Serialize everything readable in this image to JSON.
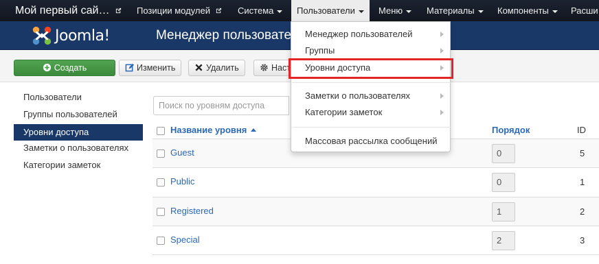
{
  "topnav": {
    "site_name": "Мой первый сай…",
    "items": [
      {
        "label": "Позиции модулей"
      },
      {
        "label": "Система"
      },
      {
        "label": "Пользователи"
      },
      {
        "label": "Меню"
      },
      {
        "label": "Материалы"
      },
      {
        "label": "Компоненты"
      },
      {
        "label": "Расши"
      }
    ]
  },
  "header": {
    "logo_text": "Joomla!",
    "page_title": "Менеджер пользователей"
  },
  "toolbar": {
    "create_label": "Создать",
    "edit_label": "Изменить",
    "delete_label": "Удалить",
    "options_label": "Настройки"
  },
  "sidebar": {
    "items": [
      {
        "label": "Пользователи"
      },
      {
        "label": "Группы пользователей"
      },
      {
        "label": "Уровни доступа"
      },
      {
        "label": "Заметки о пользователях"
      },
      {
        "label": "Категории заметок"
      }
    ]
  },
  "search": {
    "placeholder": "Поиск по уровням доступа"
  },
  "table": {
    "columns": {
      "name": "Название уровня",
      "ordering": "Порядок",
      "id": "ID"
    },
    "rows": [
      {
        "name": "Guest",
        "ordering": "0",
        "id": "5"
      },
      {
        "name": "Public",
        "ordering": "0",
        "id": "1"
      },
      {
        "name": "Registered",
        "ordering": "1",
        "id": "2"
      },
      {
        "name": "Special",
        "ordering": "2",
        "id": "3"
      }
    ]
  },
  "dropdown": {
    "items": [
      {
        "label": "Менеджер пользователей"
      },
      {
        "label": "Группы"
      },
      {
        "label": "Уровни доступа"
      },
      {
        "label": "Заметки о пользователях"
      },
      {
        "label": "Категории заметок"
      },
      {
        "label": "Массовая рассылка сообщений"
      }
    ]
  },
  "colors": {
    "navbar": "#12161f",
    "header": "#1a3867",
    "accent_link": "#2a69b8",
    "create_button": "#46a046",
    "highlight": "#e32527"
  }
}
